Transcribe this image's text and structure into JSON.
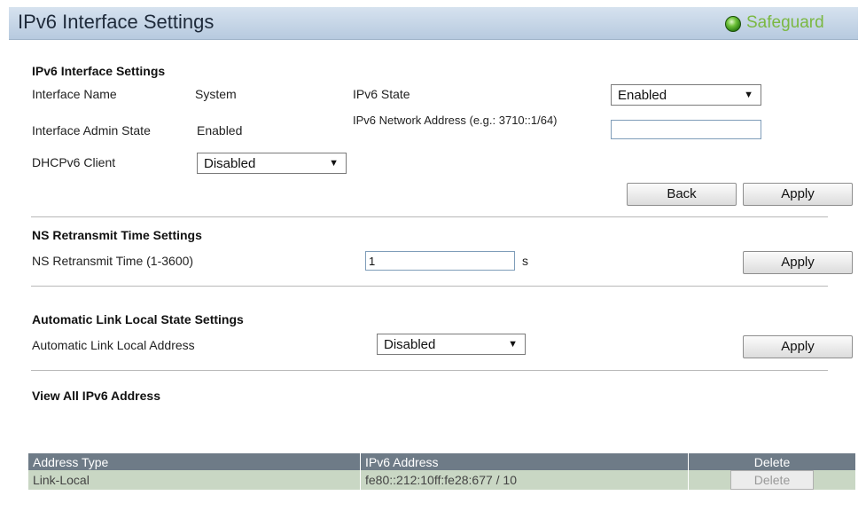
{
  "header": {
    "title": "IPv6 Interface Settings",
    "brand": "Safeguard"
  },
  "ipv6_settings": {
    "title": "IPv6 Interface Settings",
    "interface_name_label": "Interface Name",
    "interface_name_value": "System",
    "admin_state_label": "Interface Admin State",
    "admin_state_value": "Enabled",
    "dhcpv6_label": "DHCPv6 Client",
    "dhcpv6_value": "Disabled",
    "ipv6_state_label": "IPv6 State",
    "ipv6_state_value": "Enabled",
    "network_address_label": "IPv6 Network Address (e.g.: 3710::1/64)",
    "network_address_value": "",
    "back_label": "Back",
    "apply_label": "Apply"
  },
  "ns_retransmit": {
    "title": "NS Retransmit Time Settings",
    "label": "NS Retransmit Time (1-3600)",
    "value": "1",
    "unit": "s",
    "apply_label": "Apply"
  },
  "link_local": {
    "title": "Automatic Link Local State Settings",
    "label": "Automatic Link Local Address",
    "value": "Disabled",
    "apply_label": "Apply"
  },
  "view_all": {
    "title": "View All IPv6 Address",
    "columns": [
      "Address Type",
      "IPv6 Address",
      "Delete"
    ],
    "rows": [
      {
        "type": "Link-Local",
        "address": "fe80::212:10ff:fe28:677 / 10",
        "delete_label": "Delete"
      }
    ]
  },
  "colors": {
    "header_bg": "#c4d4e6",
    "brand": "#7bb842",
    "table_header": "#6e7b87",
    "table_row": "#c9d7c4"
  }
}
